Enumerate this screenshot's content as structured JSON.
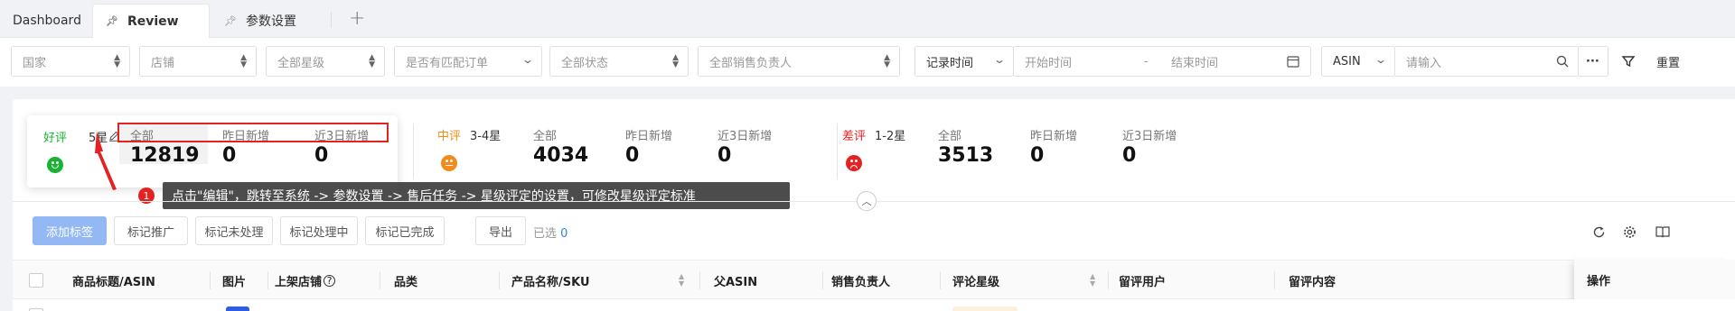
{
  "tabs": [
    {
      "label": "Dashboard"
    },
    {
      "label": "Review"
    },
    {
      "label": "参数设置"
    }
  ],
  "filters": {
    "country": "国家",
    "store": "店铺",
    "stars": "全部星级",
    "matched_order": "是否有匹配订单",
    "status": "全部状态",
    "sales_owner": "全部销售负责人",
    "time_type": "记录时间",
    "start_time": "开始时间",
    "range_sep": "-",
    "end_time": "结束时间",
    "search_field": "ASIN",
    "search_placeholder": "请输入",
    "more": "···",
    "reset": "重置"
  },
  "stats": {
    "good": {
      "label": "好评",
      "sub": "5星",
      "all_label": "全部",
      "all": "12819",
      "yesterday_label": "昨日新增",
      "yesterday": "0",
      "last3_label": "近3日新增",
      "last3": "0"
    },
    "mid": {
      "label": "中评",
      "sub": "3-4星",
      "all_label": "全部",
      "all": "4034",
      "yesterday_label": "昨日新增",
      "yesterday": "0",
      "last3_label": "近3日新增",
      "last3": "0"
    },
    "bad": {
      "label": "差评",
      "sub": "1-2星",
      "all_label": "全部",
      "all": "3513",
      "yesterday_label": "昨日新增",
      "yesterday": "0",
      "last3_label": "近3日新增",
      "last3": "0"
    }
  },
  "tooltip": {
    "badge": "1",
    "text": "点击\"编辑\"，跳转至系统 -> 参数设置 -> 售后任务 -> 星级评定的设置，可修改星级评定标准"
  },
  "actions": {
    "add_tag": "添加标签",
    "mark_promo": "标记推广",
    "mark_pending": "标记未处理",
    "mark_processing": "标记处理中",
    "mark_done": "标记已完成",
    "export": "导出",
    "selected_label": "已选",
    "selected_count": "0"
  },
  "table": {
    "columns": [
      "商品标题/ASIN",
      "图片",
      "上架店铺",
      "品类",
      "产品名称/SKU",
      "父ASIN",
      "销售负责人",
      "评论星级",
      "留评用户",
      "留评内容",
      "操作"
    ]
  },
  "colors": {
    "good": "#19b332",
    "mid": "#f08c1e",
    "bad": "#e52222",
    "primary": "#3b7ee8",
    "highlight": "#e52222"
  }
}
